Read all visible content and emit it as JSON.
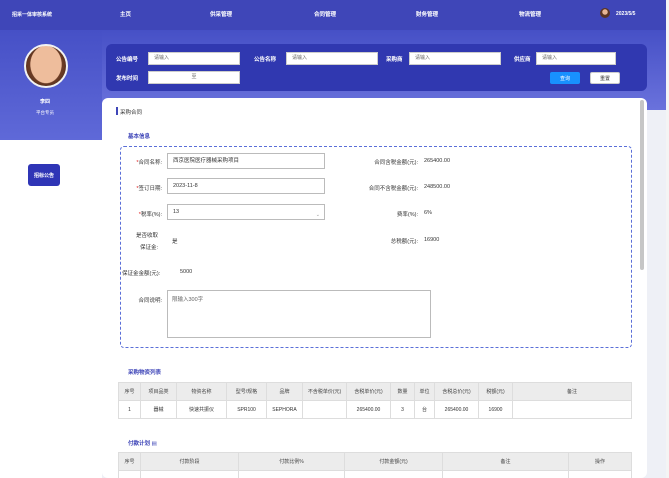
{
  "topbar": {
    "system_name": "招采一体审核系统",
    "nav": [
      "主页",
      "供采管理",
      "合同管理",
      "财务管理",
      "物流管理"
    ],
    "date": "2023/5/5"
  },
  "sidebar": {
    "user_name": "李四",
    "user_role": "平台专员",
    "menu_button": "招标公告"
  },
  "search": {
    "labels": [
      "公告编号",
      "公告名称",
      "采购商",
      "供应商",
      "发布时间"
    ],
    "placeholder": "请输入",
    "date_sep": "至",
    "query_button": "查询",
    "reset_button": "重置"
  },
  "content": {
    "title": "采购合同",
    "basic_section": "基本信息",
    "form": {
      "contract_name_label": "*合同名称:",
      "contract_name_value": "西京医院医疗器械采购项目",
      "sign_date_label": "*签订日期:",
      "sign_date_value": "2023-11-8",
      "tax_rate_label": "*税率(%):",
      "tax_rate_value": "13",
      "deposit_label_1": "是否收取",
      "deposit_label_2": "保证金:",
      "deposit_value": "是",
      "deposit_amount_label": "保证金金额(元):",
      "deposit_amount_value": "5000",
      "remark_label": "合同说明:",
      "remark_placeholder": "限输入300字",
      "total_tax_label": "合同含税金额(元):",
      "total_tax_value": "265400.00",
      "total_notax_label": "合同不含税金额(元):",
      "total_notax_value": "248500.00",
      "tax_fee_label": "费率(%):",
      "tax_fee_value": "6%",
      "total_tax_amount_label": "总税额(元):",
      "total_tax_amount_value": "16900"
    },
    "materials_section": "采购物资列表",
    "materials_table": {
      "headers": [
        "序号",
        "项目品类",
        "物资名称",
        "型号/规格",
        "品牌",
        "不含税单价(元)",
        "含税单价(元)",
        "数量",
        "单位",
        "含税总价(元)",
        "税额(元)",
        "备注"
      ],
      "rows": [
        [
          "1",
          "器械",
          "快速共振仪",
          "SPR100",
          "SEPHORA",
          "",
          "265400.00",
          "3",
          "台",
          "265400.00",
          "16900",
          ""
        ]
      ]
    },
    "payment_section": "付款计划",
    "payment_table": {
      "headers": [
        "序号",
        "付款阶段",
        "付款比例%",
        "付款金额(元)",
        "备注",
        "操作"
      ]
    }
  }
}
